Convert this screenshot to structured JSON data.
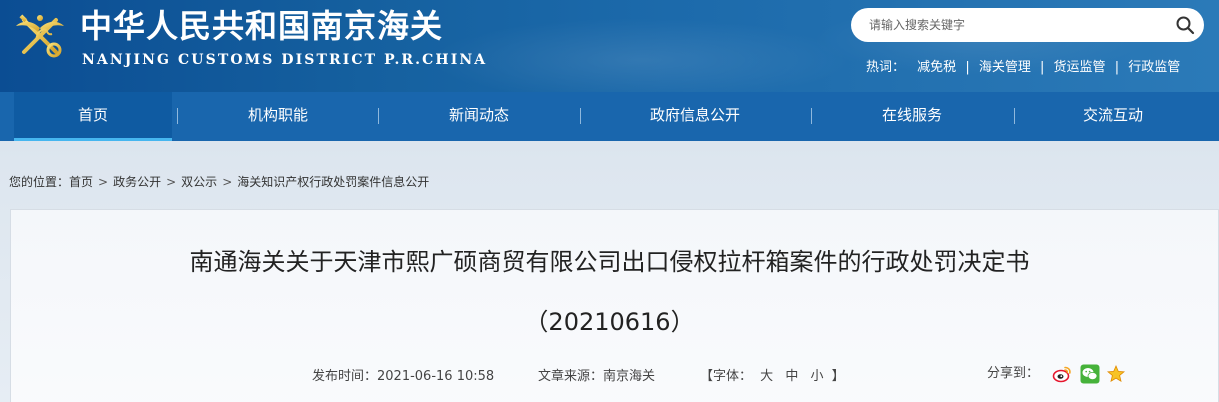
{
  "header": {
    "title_cn": "中华人民共和国南京海关",
    "title_en": "NANJING CUSTOMS DISTRICT P.R.CHINA",
    "logo_icon": "customs-emblem-icon",
    "search": {
      "placeholder": "请输入搜索关键字",
      "icon": "search-icon"
    },
    "hotwords": {
      "label": "热词：",
      "items": [
        "减免税",
        "海关管理",
        "货运监管",
        "行政监管"
      ],
      "separator": "|"
    }
  },
  "nav": {
    "items": [
      {
        "label": "首页"
      },
      {
        "label": "机构职能"
      },
      {
        "label": "新闻动态"
      },
      {
        "label": "政府信息公开"
      },
      {
        "label": "在线服务"
      },
      {
        "label": "交流互动"
      }
    ],
    "separator": "|",
    "active_index": 0,
    "colors": {
      "bar": "#1966ad",
      "active_underline": "#46b6ef"
    }
  },
  "breadcrumb": {
    "prefix": "您的位置：",
    "items": [
      "首页",
      "政务公开",
      "双公示",
      "海关知识产权行政处罚案件信息公开"
    ],
    "arrow": ">"
  },
  "article": {
    "title": "南通海关关于天津市熙广硕商贸有限公司出口侵权拉杆箱案件的行政处罚决定书",
    "subtitle": "（20210616）",
    "publish_label": "发布时间：",
    "publish_time": "2021-06-16 10:58",
    "source_label": "文章来源：",
    "source": "南京海关",
    "font_label": "【字体：",
    "font_sizes": [
      "大",
      "中",
      "小"
    ],
    "font_close": "】",
    "share_label": "分享到：",
    "share_icons": [
      "weibo-icon",
      "wechat-icon",
      "qzone-star-icon"
    ]
  }
}
